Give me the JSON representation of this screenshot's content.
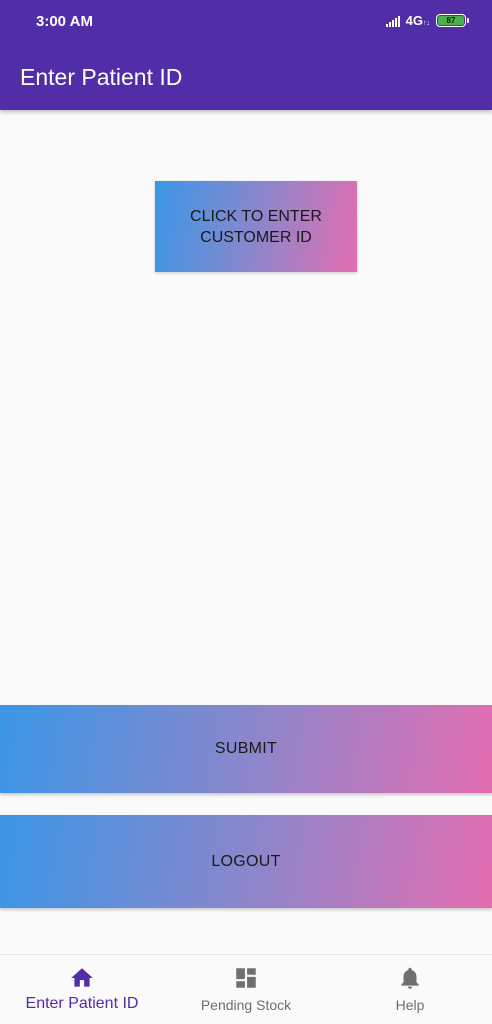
{
  "status_bar": {
    "time": "3:00 AM",
    "network": "4G",
    "battery_level": "87"
  },
  "app_bar": {
    "title": "Enter Patient ID"
  },
  "main": {
    "enter_id_button_label": "CLICK TO ENTER CUSTOMER ID",
    "submit_label": "SUBMIT",
    "logout_label": "LOGOUT"
  },
  "bottom_nav": {
    "items": [
      {
        "label": "Enter Patient ID",
        "icon": "home-icon",
        "active": true
      },
      {
        "label": "Pending Stock",
        "icon": "dashboard-icon",
        "active": false
      },
      {
        "label": "Help",
        "icon": "bell-icon",
        "active": false
      }
    ]
  },
  "colors": {
    "primary": "#512da8",
    "gradient_start": "#3a96e6",
    "gradient_end": "#e46db1",
    "inactive": "#6f6f6f"
  }
}
